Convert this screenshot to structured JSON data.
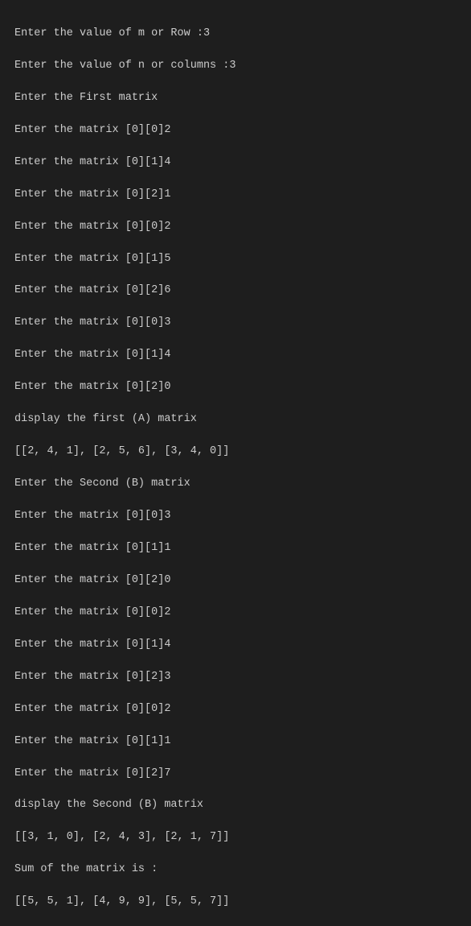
{
  "terminal": {
    "lines": [
      "Enter the value of m or Row :3",
      "Enter the value of n or columns :3",
      "Enter the First matrix",
      "Enter the matrix [0][0]2",
      "Enter the matrix [0][1]4",
      "Enter the matrix [0][2]1",
      "Enter the matrix [0][0]2",
      "Enter the matrix [0][1]5",
      "Enter the matrix [0][2]6",
      "Enter the matrix [0][0]3",
      "Enter the matrix [0][1]4",
      "Enter the matrix [0][2]0",
      "display the first (A) matrix",
      "[[2, 4, 1], [2, 5, 6], [3, 4, 0]]",
      "Enter the Second (B) matrix",
      "Enter the matrix [0][0]3",
      "Enter the matrix [0][1]1",
      "Enter the matrix [0][2]0",
      "Enter the matrix [0][0]2",
      "Enter the matrix [0][1]4",
      "Enter the matrix [0][2]3",
      "Enter the matrix [0][0]2",
      "Enter the matrix [0][1]1",
      "Enter the matrix [0][2]7",
      "display the Second (B) matrix",
      "[[3, 1, 0], [2, 4, 3], [2, 1, 7]]",
      "Sum of the matrix is :",
      "[[5, 5, 1], [4, 9, 9], [5, 5, 7]]"
    ]
  }
}
